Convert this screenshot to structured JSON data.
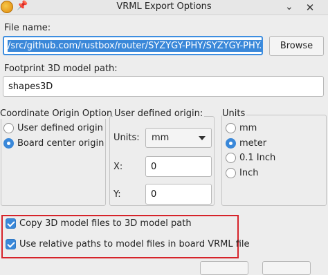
{
  "window": {
    "title": "VRML Export Options"
  },
  "file_name": {
    "label": "File name:",
    "value": "/src/github.com/rustbox/router/SYZYGY-PHY/SYZYGY-PHY.wrl",
    "browse_label": "Browse"
  },
  "footprint_path": {
    "label": "Footprint 3D model path:",
    "value": "shapes3D"
  },
  "coordinate_origin": {
    "title": "Coordinate Origin Options",
    "options": [
      {
        "label": "User defined origin",
        "selected": false
      },
      {
        "label": "Board center origin",
        "selected": true
      }
    ]
  },
  "user_origin": {
    "title": "User defined origin:",
    "units_label": "Units:",
    "units_value": "mm",
    "x_label": "X:",
    "x_value": "0",
    "y_label": "Y:",
    "y_value": "0"
  },
  "units": {
    "title": "Units",
    "options": [
      {
        "label": "mm",
        "selected": false
      },
      {
        "label": "meter",
        "selected": true
      },
      {
        "label": "0.1 Inch",
        "selected": false
      },
      {
        "label": "Inch",
        "selected": false
      }
    ]
  },
  "options": {
    "copy_models": {
      "label": "Copy 3D model files to 3D model path",
      "checked": true
    },
    "relative_paths": {
      "label": "Use relative paths to model files in board VRML file",
      "checked": true
    }
  },
  "colors": {
    "accent": "#3a88d9",
    "highlight": "#d6232a"
  }
}
